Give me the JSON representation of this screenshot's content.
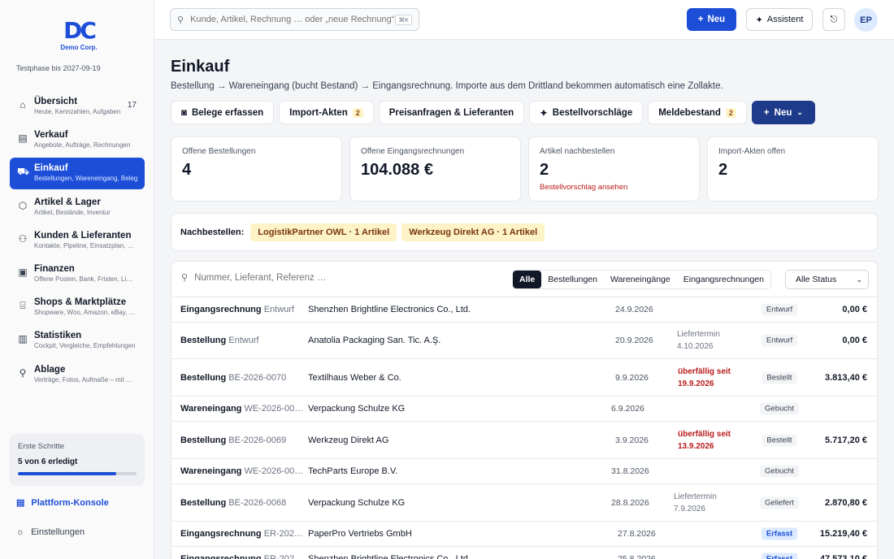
{
  "sidebar": {
    "logo_mark": "DC",
    "logo_text": "Demo Corp.",
    "trial": "Testphase bis 2027-09-19",
    "items": [
      {
        "label": "Übersicht",
        "sub": "Heute, Kennzahlen, Aufgaben",
        "count": "17",
        "icon": "home-icon"
      },
      {
        "label": "Verkauf",
        "sub": "Angebote, Aufträge, Rechnungen",
        "count": "",
        "icon": "receipt-icon"
      },
      {
        "label": "Einkauf",
        "sub": "Bestellungen, Wareneingang, Beleg",
        "count": "",
        "icon": "cart-icon",
        "active": true
      },
      {
        "label": "Artikel & Lager",
        "sub": "Artikel, Bestände, Inventur",
        "count": "",
        "icon": "box-icon"
      },
      {
        "label": "Kunden & Lieferanten",
        "sub": "Kontakte, Pipeline, Einsatzplan, …",
        "count": "",
        "icon": "users-icon"
      },
      {
        "label": "Finanzen",
        "sub": "Offene Posten, Bank, Fristen, Li…",
        "count": "",
        "icon": "wallet-icon"
      },
      {
        "label": "Shops & Marktplätze",
        "sub": "Shopware, Woo, Amazon, eBay, …",
        "count": "",
        "icon": "store-icon"
      },
      {
        "label": "Statistiken",
        "sub": "Cockpit, Vergleiche, Empfehlungen",
        "count": "",
        "icon": "chart-icon"
      },
      {
        "label": "Ablage",
        "sub": "Verträge, Fotos, Aufmaße – mit …",
        "count": "",
        "icon": "paperclip-icon"
      }
    ],
    "steps": {
      "title": "Erste Schritte",
      "progress_text": "5 von 6 erledigt",
      "progress_fraction": 0.83
    },
    "platform_label": "Plattform-Konsole",
    "settings_label": "Einstellungen"
  },
  "topbar": {
    "search_placeholder": "Kunde, Artikel, Rechnung … oder „neue Rechnung“",
    "search_kbd": "⌘K",
    "new_label": "Neu",
    "assistant_label": "Assistent",
    "avatar_initials": "EP"
  },
  "page": {
    "title": "Einkauf",
    "subtitle": "Bestellung → Wareneingang (bucht Bestand) → Eingangsrechnung. Importe aus dem Drittland bekommen automatisch eine Zollakte."
  },
  "actions": {
    "capture": "Belege erfassen",
    "import": "Import-Akten",
    "import_count": "2",
    "rfq": "Preisanfragen & Lieferanten",
    "proposals": "Bestellvorschläge",
    "reorder_level": "Meldebestand",
    "reorder_level_count": "2",
    "new": "Neu"
  },
  "kpis": [
    {
      "label": "Offene Bestellungen",
      "value": "4",
      "link": ""
    },
    {
      "label": "Offene Eingangsrechnungen",
      "value": "104.088 €",
      "link": ""
    },
    {
      "label": "Artikel nachbestellen",
      "value": "2",
      "link": "Bestellvorschlag ansehen"
    },
    {
      "label": "Import-Akten offen",
      "value": "2",
      "link": ""
    }
  ],
  "reorder": {
    "label": "Nachbestellen:",
    "chips": [
      "LogistikPartner OWL · 1 Artikel",
      "Werkzeug Direkt AG · 1 Artikel"
    ]
  },
  "table": {
    "search_placeholder": "Nummer, Lieferant, Referenz …",
    "filters": [
      "Alle",
      "Bestellungen",
      "Wareneingänge",
      "Eingangsrechnungen"
    ],
    "status_select": "Alle Status",
    "rows": [
      {
        "type": "Eingangsrechnung",
        "ref": "Entwurf",
        "party": "Shenzhen Brightline Electronics Co., Ltd.",
        "date": "24.9.2026",
        "note1": "",
        "note2": "",
        "note_kind": "",
        "status": "Entwurf",
        "status_kind": "grey",
        "amount": "0,00 €"
      },
      {
        "type": "Bestellung",
        "ref": "Entwurf",
        "party": "Anatolia Packaging San. Tic. A.Ş.",
        "date": "20.9.2026",
        "note1": "Liefertermin",
        "note2": "4.10.2026",
        "note_kind": "muted",
        "status": "Entwurf",
        "status_kind": "grey",
        "amount": "0,00 €"
      },
      {
        "type": "Bestellung",
        "ref": "BE-2026-0070",
        "party": "Textilhaus Weber & Co.",
        "date": "9.9.2026",
        "note1": "überfällig seit",
        "note2": "19.9.2026",
        "note_kind": "warn",
        "status": "Bestellt",
        "status_kind": "grey",
        "amount": "3.813,40 €"
      },
      {
        "type": "Wareneingang",
        "ref": "WE-2026-00…",
        "party": "Verpackung Schulze KG",
        "date": "6.9.2026",
        "note1": "",
        "note2": "",
        "note_kind": "",
        "status": "Gebucht",
        "status_kind": "grey",
        "amount": ""
      },
      {
        "type": "Bestellung",
        "ref": "BE-2026-0069",
        "party": "Werkzeug Direkt AG",
        "date": "3.9.2026",
        "note1": "überfällig seit",
        "note2": "13.9.2026",
        "note_kind": "warn",
        "status": "Bestellt",
        "status_kind": "grey",
        "amount": "5.717,20 €"
      },
      {
        "type": "Wareneingang",
        "ref": "WE-2026-00…",
        "party": "TechParts Europe B.V.",
        "date": "31.8.2026",
        "note1": "",
        "note2": "",
        "note_kind": "",
        "status": "Gebucht",
        "status_kind": "grey",
        "amount": ""
      },
      {
        "type": "Bestellung",
        "ref": "BE-2026-0068",
        "party": "Verpackung Schulze KG",
        "date": "28.8.2026",
        "note1": "Liefertermin",
        "note2": "7.9.2026",
        "note_kind": "muted",
        "status": "Geliefert",
        "status_kind": "grey",
        "amount": "2.870,80 €"
      },
      {
        "type": "Eingangsrechnung",
        "ref": "ER-202…",
        "party": "PaperPro Vertriebs GmbH",
        "date": "27.8.2026",
        "note1": "",
        "note2": "",
        "note_kind": "",
        "status": "Erfasst",
        "status_kind": "blue",
        "amount": "15.219,40 €"
      },
      {
        "type": "Eingangsrechnung",
        "ref": "ER-202…",
        "party": "Shenzhen Brightline Electronics Co., Ltd.",
        "date": "25.8.2026",
        "note1": "",
        "note2": "",
        "note_kind": "",
        "status": "Erfasst",
        "status_kind": "blue",
        "amount": "47.573,10 €"
      }
    ]
  },
  "colors": {
    "accent": "#1d4ed8",
    "primary_dark": "#1e3a8a",
    "warn": "#b91c1c",
    "chip_bg": "#fef3c7"
  }
}
